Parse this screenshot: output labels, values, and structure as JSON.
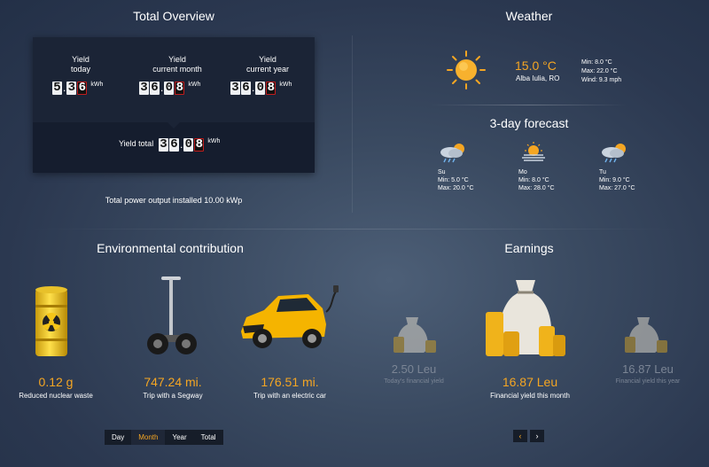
{
  "overview": {
    "title": "Total Overview",
    "yield_today": {
      "label_line1": "Yield",
      "label_line2": "today",
      "digits_white": [
        "5",
        "3"
      ],
      "digits_red": [
        "6"
      ],
      "unit": "kWh"
    },
    "yield_month": {
      "label_line1": "Yield",
      "label_line2": "current month",
      "digits_white": [
        "3",
        "6",
        "0"
      ],
      "digits_red": [
        "8"
      ],
      "unit": "kWh"
    },
    "yield_year": {
      "label_line1": "Yield",
      "label_line2": "current year",
      "digits_white": [
        "3",
        "6",
        "0"
      ],
      "digits_red": [
        "8"
      ],
      "unit": "kWh"
    },
    "yield_total": {
      "label": "Yield total",
      "digits_white": [
        "3",
        "6",
        "0"
      ],
      "digits_red": [
        "8"
      ],
      "unit": "kWh"
    },
    "power_note": "Total power output installed 10.00 kWp"
  },
  "weather": {
    "title": "Weather",
    "temperature": "15.0 °C",
    "location": "Alba Iulia, RO",
    "min": "Min: 8.0 °C",
    "max": "Max: 22.0 °C",
    "wind": "Wind: 9.3 mph",
    "icon": "sun-icon",
    "forecast_title": "3-day forecast",
    "forecast": [
      {
        "day": "Su",
        "min": "Min: 5.0 °C",
        "max": "Max: 20.0 °C",
        "icon": "rain-cloud-icon"
      },
      {
        "day": "Mo",
        "min": "Min: 8.0 °C",
        "max": "Max: 28.0 °C",
        "icon": "fog-sun-icon"
      },
      {
        "day": "Tu",
        "min": "Min: 9.0 °C",
        "max": "Max: 27.0 °C",
        "icon": "rain-cloud-icon"
      }
    ]
  },
  "environment": {
    "title": "Environmental contribution",
    "items": [
      {
        "value": "0.12 g",
        "label": "Reduced nuclear waste",
        "icon": "nuclear-barrel-icon"
      },
      {
        "value": "747.24 mi.",
        "label": "Trip with a Segway",
        "icon": "segway-icon"
      },
      {
        "value": "176.51 mi.",
        "label": "Trip with an electric car",
        "icon": "electric-car-icon"
      }
    ],
    "tabs": [
      "Day",
      "Month",
      "Year",
      "Total"
    ],
    "active_tab": "Month"
  },
  "earnings": {
    "title": "Earnings",
    "items": [
      {
        "value": "2.50 Leu",
        "label": "Today's financial yield",
        "icon": "money-bag-icon"
      },
      {
        "value": "16.87 Leu",
        "label": "Financial yield this month",
        "icon": "money-bag-icon"
      },
      {
        "value": "16.87 Leu",
        "label": "Financial yield this year",
        "icon": "money-bag-icon"
      }
    ],
    "prev": "‹",
    "next": "›"
  },
  "colors": {
    "accent": "#f5a623",
    "counter_red": "#c21d1d",
    "panel": "#151d2e"
  }
}
